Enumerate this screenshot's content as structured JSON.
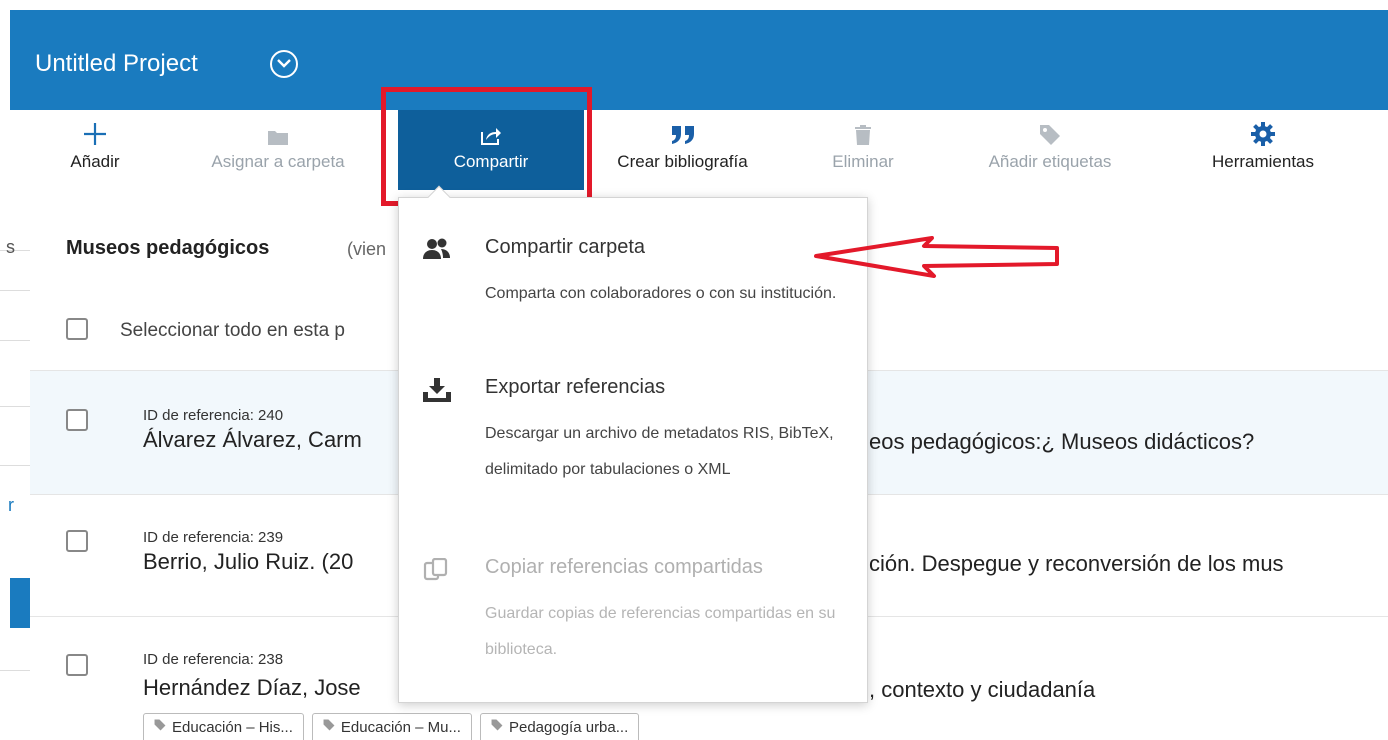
{
  "header": {
    "project_title": "Untitled Project",
    "chevron_icon": "chevron-down-icon"
  },
  "toolbar": {
    "add": {
      "label": "Añadir",
      "icon": "plus-icon"
    },
    "assign_folder": {
      "label": "Asignar a carpeta",
      "icon": "folder-icon"
    },
    "share": {
      "label": "Compartir",
      "icon": "share-icon"
    },
    "bibliography": {
      "label": "Crear bibliografía",
      "icon": "quote-icon"
    },
    "delete": {
      "label": "Eliminar",
      "icon": "trash-icon"
    },
    "tags": {
      "label": "Añadir etiquetas",
      "icon": "tag-icon"
    },
    "tools": {
      "label": "Herramientas",
      "icon": "gear-icon"
    }
  },
  "sidebar": {
    "partial_1": "s",
    "partial_2": "r"
  },
  "folder": {
    "title": "Museos pedagógicos",
    "subtitle": "(vien"
  },
  "select_all": "Seleccionar todo en esta p",
  "references": [
    {
      "id_label": "ID de referencia: 240",
      "title_start": "Álvarez Álvarez, Carm",
      "title_end": "eos pedagógicos:¿ Museos didácticos?"
    },
    {
      "id_label": "ID de referencia: 239",
      "title_start": "Berrio, Julio Ruiz. (20",
      "title_end": "ción. Despegue y reconversión de los mus"
    },
    {
      "id_label": "ID de referencia: 238",
      "title_start": "Hernández Díaz, Jose",
      "title_end": ", contexto y ciudadanía"
    }
  ],
  "tags": [
    "Educación – His...",
    "Educación – Mu...",
    "Pedagogía urba..."
  ],
  "share_menu": {
    "items": [
      {
        "title": "Compartir carpeta",
        "description": "Comparta con colaboradores o con su institución.",
        "icon": "users-icon"
      },
      {
        "title": "Exportar referencias",
        "description": "Descargar un archivo de metadatos RIS, BibTeX, delimitado por tabulaciones o XML",
        "icon": "download-icon"
      },
      {
        "title": "Copiar referencias compartidas",
        "description": "Guardar copias de referencias compartidas en su biblioteca.",
        "icon": "copy-icon"
      }
    ]
  },
  "colors": {
    "header_blue": "#1a7bbf",
    "share_active": "#0e5f9b",
    "highlight_red": "#e3192a"
  }
}
